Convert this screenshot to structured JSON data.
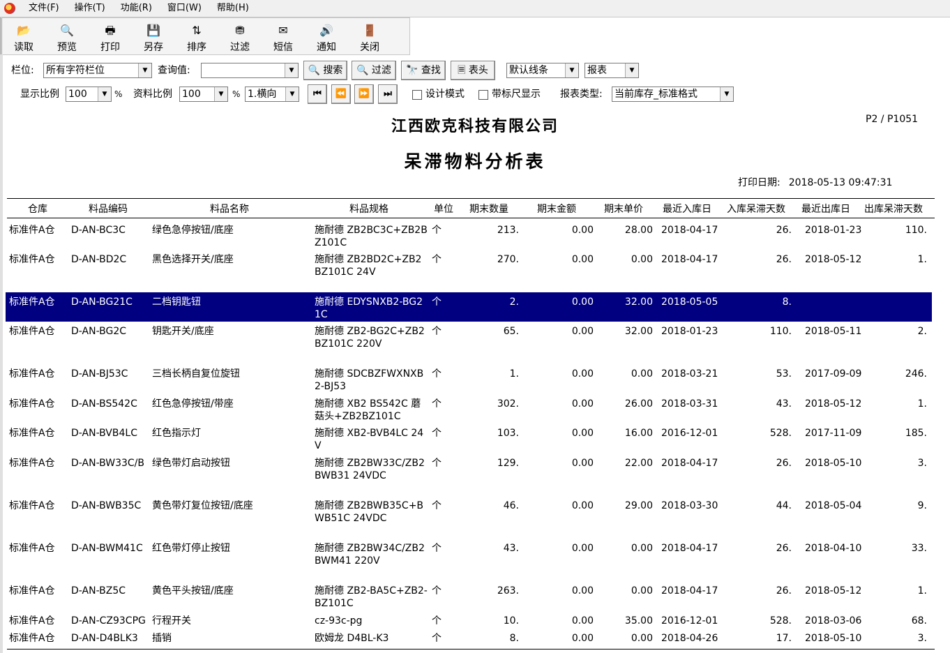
{
  "menu": [
    "文件(F)",
    "操作(T)",
    "功能(R)",
    "窗口(W)",
    "帮助(H)"
  ],
  "toolbar": [
    {
      "label": "读取",
      "icon": "📂"
    },
    {
      "label": "预览",
      "icon": "🔍"
    },
    {
      "label": "打印",
      "icon": "🖶"
    },
    {
      "label": "另存",
      "icon": "💾"
    },
    {
      "label": "排序",
      "icon": "⇅"
    },
    {
      "label": "过滤",
      "icon": "⛃"
    },
    {
      "label": "短信",
      "icon": "✉"
    },
    {
      "label": "通知",
      "icon": "🔊"
    },
    {
      "label": "关闭",
      "icon": "🚪"
    }
  ],
  "filter": {
    "field_label": "栏位:",
    "field_value": "所有字符栏位",
    "query_label": "查询值:",
    "query_value": "",
    "search_btn": "🔍 搜索",
    "filter_btn": "🔍 过滤",
    "find_btn": "🔭 查找",
    "header_btn": "🗏 表头",
    "line_style": "默认线条",
    "report_mode": "报表"
  },
  "view": {
    "display_ratio_label": "显示比例",
    "display_ratio": "100",
    "pct1": "%",
    "data_ratio_label": "资料比例",
    "data_ratio": "100",
    "pct2": "%",
    "orientation": "1.横向",
    "nav": [
      "⏮",
      "⏪",
      "⏩",
      "⏭"
    ],
    "design_mode": "设计模式",
    "ruler": "带标尺显示",
    "report_type_label": "报表类型:",
    "report_type": "当前库存_标准格式"
  },
  "report": {
    "company": "江西欧克科技有限公司",
    "title": "呆滞物料分析表",
    "page": "P2 / P1051",
    "print_date_label": "打印日期:",
    "print_date": "2018-05-13 09:47:31",
    "headers": [
      "仓库",
      "料品编码",
      "料品名称",
      "料品规格",
      "单位",
      "期末数量",
      "期末金额",
      "期末单价",
      "最近入库日",
      "入库呆滞天数",
      "最近出库日",
      "出库呆滞天数"
    ],
    "rows": [
      {
        "wh": "标准件A仓",
        "code": "D-AN-BC3C",
        "name": "绿色急停按钮/底座",
        "spec": "施耐德 ZB2BC3C+ZB2BZ101C",
        "unit": "个",
        "qty": "213.",
        "amt": "0.00",
        "price": "28.00",
        "in": "2018-04-17",
        "indays": "26.",
        "out": "2018-01-23",
        "outdays": "110."
      },
      {
        "wh": "标准件A仓",
        "code": "D-AN-BD2C",
        "name": "黑色选择开关/底座",
        "spec": "施耐德 ZB2BD2C+ZB2BZ101C 24V",
        "unit": "个",
        "qty": "270.",
        "amt": "0.00",
        "price": "0.00",
        "in": "2018-04-17",
        "indays": "26.",
        "out": "2018-05-12",
        "outdays": "1."
      },
      {
        "wh": "标准件A仓",
        "code": "D-AN-BG21C",
        "name": "二档钥匙钮",
        "spec": "施耐德 EDYSNXB2-BG21C",
        "unit": "个",
        "qty": "2.",
        "amt": "0.00",
        "price": "32.00",
        "in": "2018-05-05",
        "indays": "8.",
        "out": "",
        "outdays": ""
      },
      {
        "wh": "标准件A仓",
        "code": "D-AN-BG2C",
        "name": "钥匙开关/底座",
        "spec": "施耐德 ZB2-BG2C+ZB2BZ101C 220V",
        "unit": "个",
        "qty": "65.",
        "amt": "0.00",
        "price": "32.00",
        "in": "2018-01-23",
        "indays": "110.",
        "out": "2018-05-11",
        "outdays": "2."
      },
      {
        "wh": "标准件A仓",
        "code": "D-AN-BJ53C",
        "name": "三档长柄自复位旋钮",
        "spec": "施耐德 SDCBZFWXNXB2-BJ53",
        "unit": "个",
        "qty": "1.",
        "amt": "0.00",
        "price": "0.00",
        "in": "2018-03-21",
        "indays": "53.",
        "out": "2017-09-09",
        "outdays": "246."
      },
      {
        "wh": "标准件A仓",
        "code": "D-AN-BS542C",
        "name": "红色急停按钮/带座",
        "spec": "施耐德 XB2 BS542C 蘑菇头+ZB2BZ101C",
        "unit": "个",
        "qty": "302.",
        "amt": "0.00",
        "price": "26.00",
        "in": "2018-03-31",
        "indays": "43.",
        "out": "2018-05-12",
        "outdays": "1."
      },
      {
        "wh": "标准件A仓",
        "code": "D-AN-BVB4LC",
        "name": "红色指示灯",
        "spec": "施耐德 XB2-BVB4LC 24V",
        "unit": "个",
        "qty": "103.",
        "amt": "0.00",
        "price": "16.00",
        "in": "2016-12-01",
        "indays": "528.",
        "out": "2017-11-09",
        "outdays": "185."
      },
      {
        "wh": "标准件A仓",
        "code": "D-AN-BW33C/B",
        "name": "绿色带灯启动按钮",
        "spec": "施耐德 ZB2BW33C/ZB2BWB31 24VDC",
        "unit": "个",
        "qty": "129.",
        "amt": "0.00",
        "price": "22.00",
        "in": "2018-04-17",
        "indays": "26.",
        "out": "2018-05-10",
        "outdays": "3."
      },
      {
        "wh": "标准件A仓",
        "code": "D-AN-BWB35C",
        "name": "黄色带灯复位按钮/底座",
        "spec": "施耐德 ZB2BWB35C+BWB51C 24VDC",
        "unit": "个",
        "qty": "46.",
        "amt": "0.00",
        "price": "29.00",
        "in": "2018-03-30",
        "indays": "44.",
        "out": "2018-05-04",
        "outdays": "9."
      },
      {
        "wh": "标准件A仓",
        "code": "D-AN-BWM41C",
        "name": "红色带灯停止按钮",
        "spec": "施耐德 ZB2BW34C/ZB2BWM41 220V",
        "unit": "个",
        "qty": "43.",
        "amt": "0.00",
        "price": "0.00",
        "in": "2018-04-17",
        "indays": "26.",
        "out": "2018-04-10",
        "outdays": "33."
      },
      {
        "wh": "标准件A仓",
        "code": "D-AN-BZ5C",
        "name": "黄色平头按钮/底座",
        "spec": "施耐德 ZB2-BA5C+ZB2-BZ101C",
        "unit": "个",
        "qty": "263.",
        "amt": "0.00",
        "price": "0.00",
        "in": "2018-04-17",
        "indays": "26.",
        "out": "2018-05-12",
        "outdays": "1."
      },
      {
        "wh": "标准件A仓",
        "code": "D-AN-CZ93CPG",
        "name": "行程开关",
        "spec": "cz-93c-pg",
        "unit": "个",
        "qty": "10.",
        "amt": "0.00",
        "price": "35.00",
        "in": "2016-12-01",
        "indays": "528.",
        "out": "2018-03-06",
        "outdays": "68."
      },
      {
        "wh": "标准件A仓",
        "code": "D-AN-D4BLK3",
        "name": "插销",
        "spec": "欧姆龙  D4BL-K3",
        "unit": "个",
        "qty": "8.",
        "amt": "0.00",
        "price": "0.00",
        "in": "2018-04-26",
        "indays": "17.",
        "out": "2018-05-10",
        "outdays": "3."
      }
    ]
  }
}
